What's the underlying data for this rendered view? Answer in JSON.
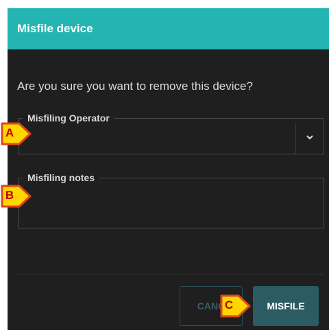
{
  "dialog": {
    "title": "Misfile device",
    "question": "Are you sure you want to remove this device?",
    "operator_field": {
      "legend": "Misfiling Operator",
      "value": "",
      "icon": "chevron-down-icon"
    },
    "notes_field": {
      "legend": "Misfiling notes",
      "value": ""
    },
    "buttons": {
      "cancel_label": "CANC",
      "misfile_label": "MISFILE"
    }
  },
  "markers": {
    "a": "A",
    "b": "B",
    "c": "C"
  },
  "colors": {
    "header": "#24b5b3",
    "body": "#1f1f1f",
    "primary_button": "#2b5c64",
    "marker_fill": "#ffd700",
    "marker_border": "#e0451c",
    "marker_text": "#c00000"
  }
}
